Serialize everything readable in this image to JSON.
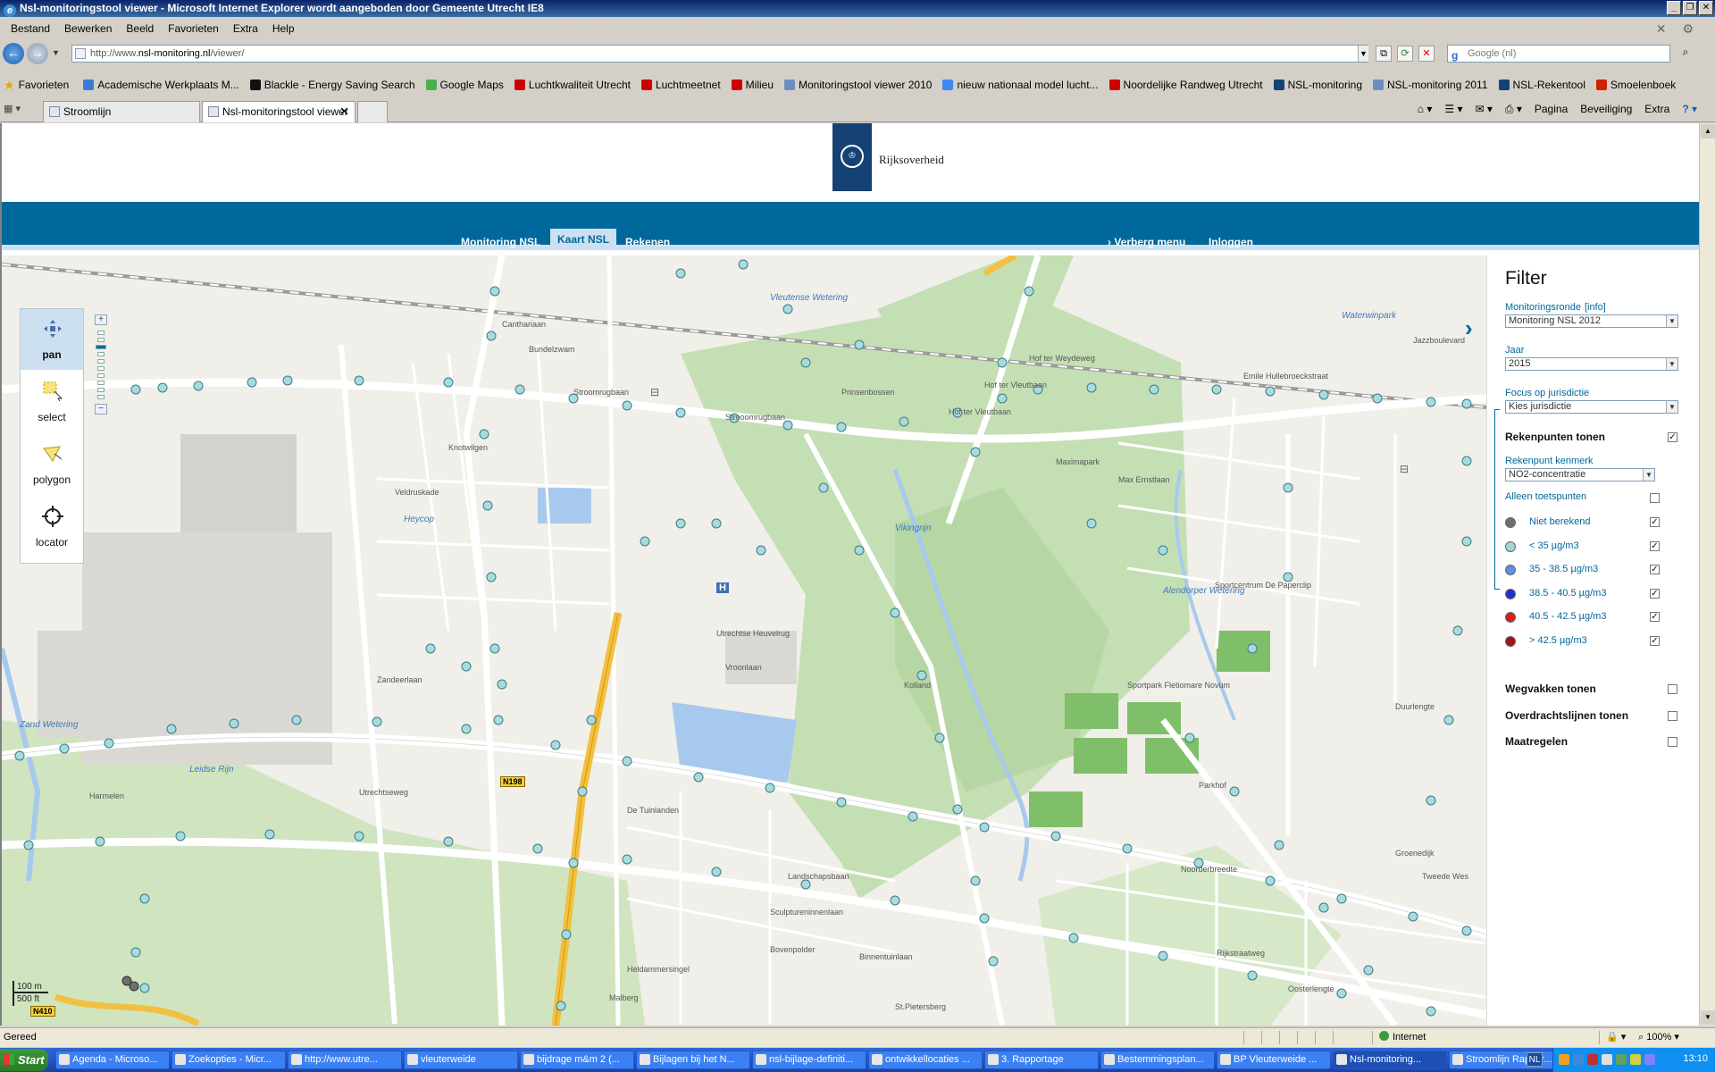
{
  "window": {
    "title": "Nsl-monitoringstool viewer - Microsoft Internet Explorer wordt aangeboden door Gemeente Utrecht IE8"
  },
  "menubar": [
    "Bestand",
    "Bewerken",
    "Beeld",
    "Favorieten",
    "Extra",
    "Help"
  ],
  "address": {
    "prefix": "http://www.",
    "host": "nsl-monitoring.nl",
    "suffix": "/viewer/",
    "search_placeholder": "Google (nl)"
  },
  "favorites": {
    "label": "Favorieten",
    "items": [
      {
        "label": "Academische Werkplaats M...",
        "color": "#3a7bd5"
      },
      {
        "label": "Blackle - Energy Saving Search",
        "color": "#111111"
      },
      {
        "label": "Google Maps",
        "color": "#4caf50"
      },
      {
        "label": "Luchtkwaliteit Utrecht",
        "color": "#cc0000"
      },
      {
        "label": "Luchtmeetnet",
        "color": "#cc0000"
      },
      {
        "label": "Milieu",
        "color": "#cc0000"
      },
      {
        "label": "Monitoringstool viewer 2010",
        "color": "#6c8ebf"
      },
      {
        "label": "nieuw nationaal model lucht...",
        "color": "#4285f4"
      },
      {
        "label": "Noordelijke Randweg Utrecht",
        "color": "#cc0000"
      },
      {
        "label": "NSL-monitoring",
        "color": "#154273"
      },
      {
        "label": "NSL-monitoring 2011",
        "color": "#6c8ebf"
      },
      {
        "label": "NSL-Rekentool",
        "color": "#154273"
      },
      {
        "label": "Smoelenboek",
        "color": "#cc2200"
      }
    ]
  },
  "tabs": [
    {
      "label": "Stroomlijn",
      "active": false
    },
    {
      "label": "Nsl-monitoringstool viewer",
      "active": true
    }
  ],
  "commandbar": [
    "Pagina",
    "Beveiliging",
    "Extra"
  ],
  "site": {
    "logo_text": "Rijksoverheid",
    "nav": [
      {
        "label": "Monitoring NSL",
        "active": false
      },
      {
        "label": "Kaart NSL",
        "active": true
      },
      {
        "label": "Rekenen",
        "active": false
      }
    ],
    "nav_hide": "Verberg menu",
    "nav_login": "Inloggen"
  },
  "map": {
    "tools": [
      {
        "label": "pan",
        "icon": "pan-icon",
        "active": true
      },
      {
        "label": "select",
        "icon": "select-icon",
        "active": false
      },
      {
        "label": "polygon",
        "icon": "polygon-icon",
        "active": false
      },
      {
        "label": "locator",
        "icon": "locator-icon",
        "active": false
      }
    ],
    "scale": {
      "top": "100 m",
      "bottom": "500 ft"
    },
    "labels": {
      "streets": [
        "Canthariaan",
        "Bundelzwam",
        "Stroomrugbaan",
        "Strooomrugbaan",
        "Vleutense Wetering",
        "Hof ter Weydeweg",
        "Emile Hullebroeckstraat",
        "Waterwinpark",
        "Jazzboulevard",
        "Prinsenbossen",
        "Hof ter Vleutbaan",
        "Maximapark",
        "Max Ernstlaan",
        "Vikingrijn",
        "Alendorper Wetering",
        "Sportcentrum De Paperclip",
        "Sportpark Fletiomare Novum",
        "Parkhof",
        "Landschapsbaan",
        "Utrechtse Heuvelrug",
        "Heycop",
        "Zand Wetering",
        "Leidse Rijn",
        "Harmelen",
        "Utrechtseweg",
        "De Tuinlanden",
        "Sculptureninnenlaan",
        "Binnentuinlaan",
        "Noorderbreedte",
        "Groenedijk",
        "Rijkstraatweg",
        "St.Pietersberg",
        "Heldammersingel",
        "Malberg",
        "Bovenpolder",
        "Knotwilgen",
        "Veldruskade",
        "Vroonlaan",
        "Kolland",
        "Oosterlengte",
        "Tweede Wes",
        "Hof ter Vleutbaan",
        "Zandeerlaan",
        "Duurlengte"
      ],
      "road_shields": [
        "N198",
        "N410"
      ]
    }
  },
  "filter": {
    "title": "Filter",
    "monitoringsronde": {
      "label": "Monitoringsronde",
      "info": "[info]",
      "value": "Monitoring NSL 2012"
    },
    "jaar": {
      "label": "Jaar",
      "value": "2015"
    },
    "jurisdictie": {
      "label": "Focus op jurisdictie",
      "value": "Kies jurisdictie"
    },
    "rekenpunten": {
      "label": "Rekenpunten tonen",
      "checked": true
    },
    "kenmerk": {
      "label": "Rekenpunt kenmerk",
      "value": "NO2-concentratie"
    },
    "toetspunten": {
      "label": "Alleen toetspunten",
      "checked": false
    },
    "legend": [
      {
        "label": "Niet berekend",
        "color": "#6e6e6e",
        "checked": true
      },
      {
        "label": "< 35 µg/m3",
        "color": "#9fd6d6",
        "checked": true
      },
      {
        "label": "35 - 38.5 µg/m3",
        "color": "#5b8ee6",
        "checked": true
      },
      {
        "label": "38.5 - 40.5 µg/m3",
        "color": "#1f2fcf",
        "checked": true
      },
      {
        "label": "40.5 - 42.5 µg/m3",
        "color": "#d81e1e",
        "checked": true
      },
      {
        "label": "> 42.5 µg/m3",
        "color": "#a4111b",
        "checked": true
      }
    ],
    "wegvakken": {
      "label": "Wegvakken tonen",
      "checked": false
    },
    "overdracht": {
      "label": "Overdrachtslijnen tonen",
      "checked": false
    },
    "maatregelen": {
      "label": "Maatregelen",
      "checked": false
    }
  },
  "statusbar": {
    "left": "Gereed",
    "zone": "Internet",
    "zoom": "100%"
  },
  "taskbar": {
    "start": "Start",
    "tasks": [
      {
        "label": "Agenda - Microso...",
        "active": false
      },
      {
        "label": "Zoekopties - Micr...",
        "active": false
      },
      {
        "label": "http://www.utre...",
        "active": false
      },
      {
        "label": "vleuterweide",
        "active": false
      },
      {
        "label": "bijdrage m&m 2 (...",
        "active": false
      },
      {
        "label": "Bijlagen bij het N...",
        "active": false
      },
      {
        "label": "nsl-bijlage-definiti...",
        "active": false
      },
      {
        "label": "ontwikkellocaties ...",
        "active": false
      },
      {
        "label": "3. Rapportage",
        "active": false
      },
      {
        "label": "Bestemmingsplan...",
        "active": false
      },
      {
        "label": "BP Vleuterweide ...",
        "active": false
      },
      {
        "label": "Nsl-monitoring...",
        "active": true
      },
      {
        "label": "Stroomlijn Rappor...",
        "active": false
      }
    ],
    "lang": "NL",
    "clock": "13:10"
  }
}
